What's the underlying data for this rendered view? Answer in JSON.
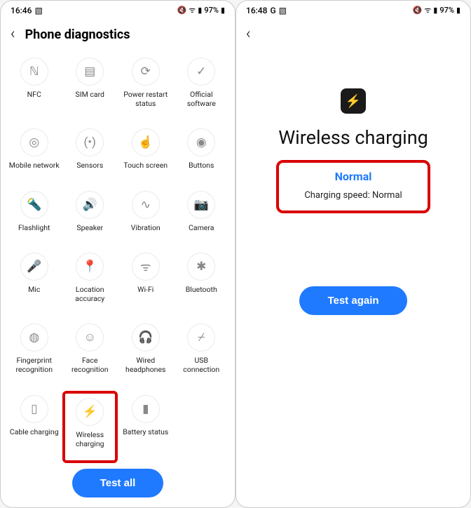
{
  "left": {
    "status": {
      "time": "16:46",
      "extra": "",
      "battery": "97%"
    },
    "header": {
      "title": "Phone diagnostics"
    },
    "items": [
      {
        "label": "NFC",
        "icon": "ℕ"
      },
      {
        "label": "SIM card",
        "icon": "▤"
      },
      {
        "label": "Power restart status",
        "icon": "⟳"
      },
      {
        "label": "Official software",
        "icon": "✓"
      },
      {
        "label": "Mobile network",
        "icon": "◎"
      },
      {
        "label": "Sensors",
        "icon": "(•)"
      },
      {
        "label": "Touch screen",
        "icon": "☝"
      },
      {
        "label": "Buttons",
        "icon": "◉"
      },
      {
        "label": "Flashlight",
        "icon": "🔦"
      },
      {
        "label": "Speaker",
        "icon": "🔊"
      },
      {
        "label": "Vibration",
        "icon": "∿"
      },
      {
        "label": "Camera",
        "icon": "📷"
      },
      {
        "label": "Mic",
        "icon": "🎤"
      },
      {
        "label": "Location accuracy",
        "icon": "📍"
      },
      {
        "label": "Wi-Fi",
        "icon": "ᯤ"
      },
      {
        "label": "Bluetooth",
        "icon": "✱"
      },
      {
        "label": "Fingerprint recognition",
        "icon": "◍"
      },
      {
        "label": "Face recognition",
        "icon": "☺"
      },
      {
        "label": "Wired headphones",
        "icon": "🎧"
      },
      {
        "label": "USB connection",
        "icon": "⌿"
      },
      {
        "label": "Cable charging",
        "icon": "▯"
      },
      {
        "label": "Wireless charging",
        "icon": "⚡"
      },
      {
        "label": "Battery status",
        "icon": "▮"
      }
    ],
    "highlight_index": 21,
    "test_all": "Test all"
  },
  "right": {
    "status": {
      "time": "16:48",
      "extra": "G",
      "battery": "97%"
    },
    "result": {
      "title": "Wireless charging",
      "status": "Normal",
      "detail": "Charging speed: Normal"
    },
    "test_again": "Test again"
  }
}
